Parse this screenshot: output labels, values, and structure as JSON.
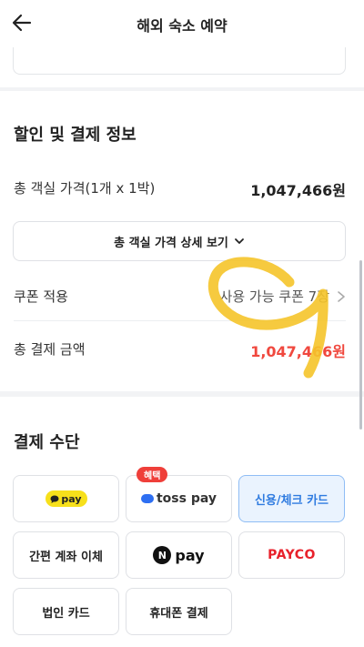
{
  "header": {
    "title": "해외 숙소 예약",
    "back_icon": "arrow-left-icon"
  },
  "discount_section": {
    "title": "할인 및 결제 정보",
    "room_price_label": "총 객실 가격(1개 x 1박)",
    "room_price_value": "1,047,466원",
    "detail_button_label": "총 객실 가격 상세 보기",
    "coupon_label": "쿠폰 적용",
    "coupon_value": "사용 가능 쿠폰 7장",
    "total_label": "총 결제 금액",
    "total_value": "1,047,466원"
  },
  "payment_section": {
    "title": "결제 수단",
    "methods": {
      "kakao": "pay",
      "toss": "toss pay",
      "card": "신용/체크 카드",
      "bank": "간편 계좌 이체",
      "naver": "pay",
      "naver_mark": "N",
      "payco": "PAYCO",
      "corporate": "법인 카드",
      "phone": "휴대폰 결제"
    },
    "toss_badge": "혜택",
    "selected": "card"
  },
  "colors": {
    "accent_red": "#f0483e",
    "selected_blue": "#2f7be0",
    "kakao_yellow": "#f7e01b",
    "annotation_yellow": "#f5c42a"
  }
}
